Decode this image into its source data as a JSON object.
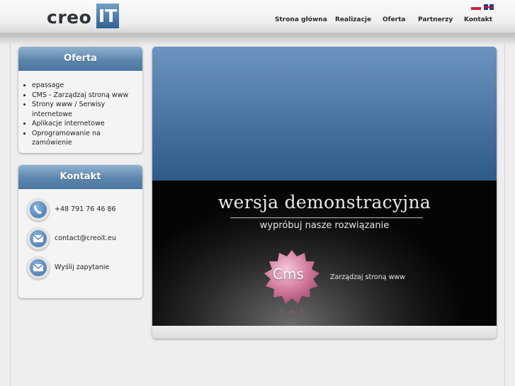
{
  "brand": {
    "logo_word": "creo",
    "logo_mark": "IT"
  },
  "languages": [
    {
      "code": "PL",
      "icon": "poland-flag-icon"
    },
    {
      "code": "EN",
      "icon": "uk-flag-icon"
    }
  ],
  "nav": {
    "items": [
      {
        "label": "Strona główna"
      },
      {
        "label": "Realizacje"
      },
      {
        "label": "Oferta"
      },
      {
        "label": "Partnerzy"
      },
      {
        "label": "Kontakt"
      }
    ]
  },
  "sidebar": {
    "offer": {
      "title": "Oferta",
      "items": [
        "epassage",
        "CMS - Zarządzaj stroną www",
        "Strony www / Serwisy internetowe",
        "Aplikacje internetowe",
        "Oprogramowanie na zamówienie"
      ]
    },
    "contact": {
      "title": "Kontakt",
      "items": [
        {
          "icon": "phone-icon",
          "text": "+48 791 76 46 86"
        },
        {
          "icon": "envelope-icon",
          "text": "contact@creoit.eu"
        },
        {
          "icon": "envelope-icon",
          "text": "Wyślij zapytanie"
        }
      ]
    }
  },
  "banner": {
    "title": "wersja demonstracyjna",
    "subtitle": "wypróbuj nasze rozwiązanie",
    "badge_text": "Cms",
    "badge_caption": "Zarządzaj stroną www"
  },
  "colors": {
    "accent_blue": "#4a76a1",
    "header_bg": "#f2f2f2",
    "banner_dark": "#0a0a0a",
    "badge_pink": "#d58aa8"
  }
}
